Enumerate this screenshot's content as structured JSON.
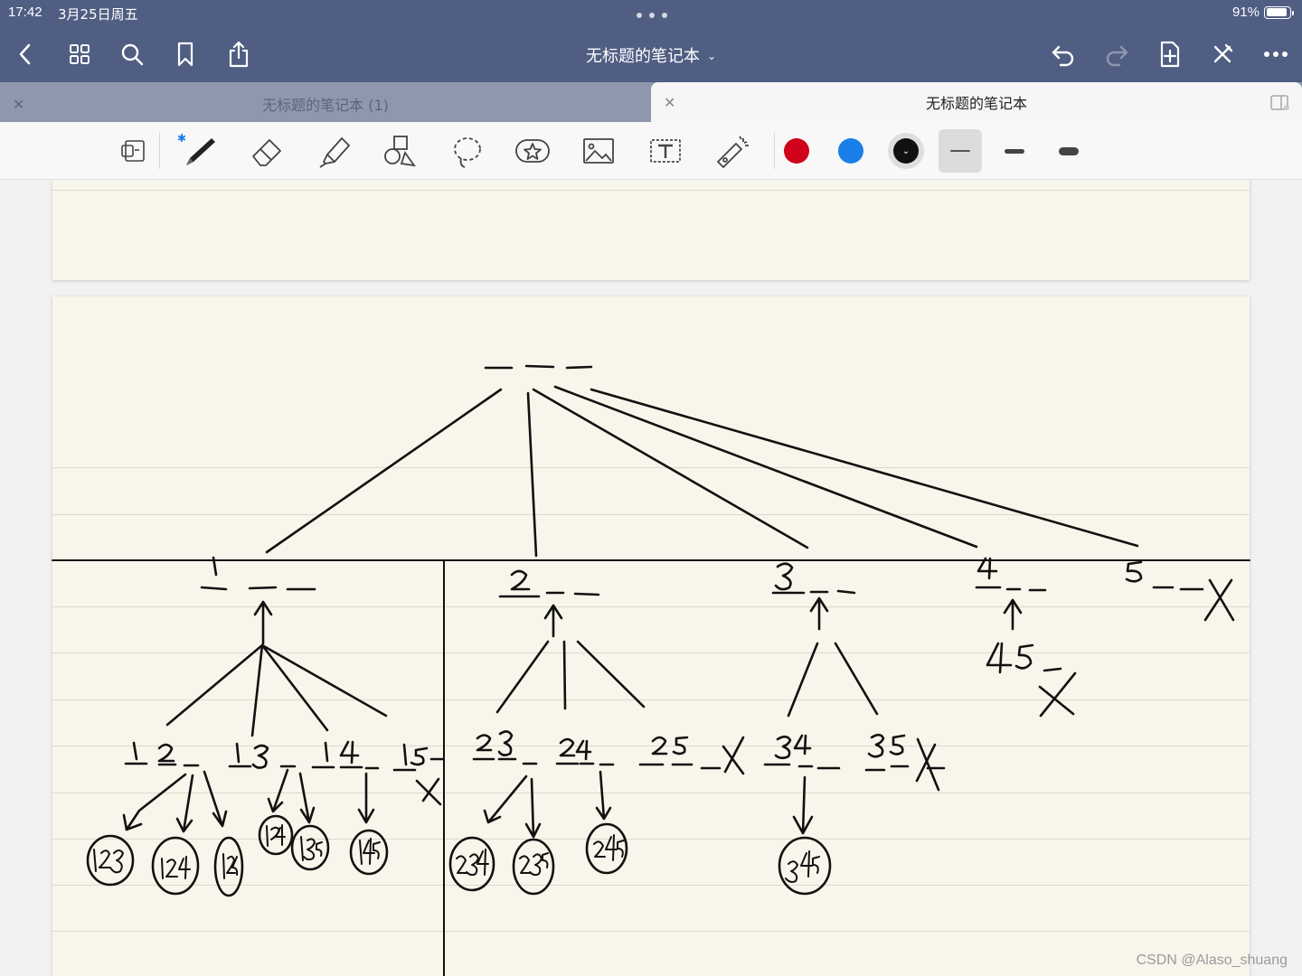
{
  "status": {
    "time": "17:42",
    "date": "3月25日周五",
    "battery": "91%",
    "battery_level": 0.91
  },
  "nav": {
    "title": "无标题的笔记本",
    "icons": [
      "back-icon",
      "grid-icon",
      "search-icon",
      "bookmark-icon",
      "share-icon",
      "undo-icon",
      "redo-icon",
      "add-page-icon",
      "close-tools-icon",
      "more-icon"
    ]
  },
  "tabs": [
    {
      "label": "无标题的笔记本 (1)",
      "active": false
    },
    {
      "label": "无标题的笔记本",
      "active": true
    }
  ],
  "toolbar": {
    "tools": [
      "page-tool",
      "pen",
      "eraser",
      "highlighter",
      "shapes",
      "lasso",
      "sticker",
      "image",
      "text",
      "laser-pointer"
    ],
    "colors": [
      "#d0021b",
      "#1a7ee8",
      "#111111"
    ],
    "selected_color": "#111111",
    "stroke_widths": [
      "thin",
      "medium",
      "thick"
    ],
    "selected_stroke": "thin"
  },
  "notes": {
    "top_level": [
      "1",
      "2",
      "3",
      "4",
      "5"
    ],
    "level2": [
      "12",
      "13",
      "14",
      "15",
      "23",
      "24",
      "25",
      "34",
      "35",
      "45"
    ],
    "level3": [
      "123",
      "124",
      "125",
      "134",
      "135",
      "145",
      "234",
      "235",
      "245",
      "345"
    ]
  },
  "watermark": "CSDN @Alaso_shuang"
}
